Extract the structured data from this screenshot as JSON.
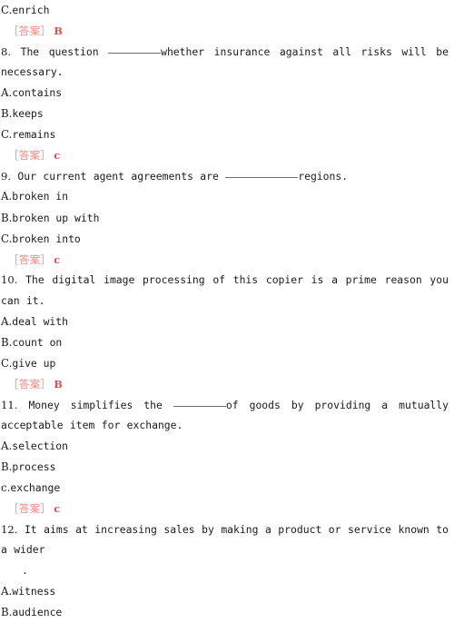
{
  "document": {
    "background_color": "#ffffff",
    "text_color": "#1b1b1b",
    "answer_color": "#e8736f",
    "answer_value_color": "#d9534f",
    "answer_label": "［答案］"
  },
  "top_partial_option": {
    "letter": "C.",
    "text": "enrich"
  },
  "top_partial_answer": {
    "label": "［答案］",
    "value": "B"
  },
  "questions": [
    {
      "number": "8.",
      "stem_before": " The question ",
      "blank": "short",
      "stem_after": "whether insurance against all risks will be necessary.",
      "options": [
        {
          "letter": "A.",
          "text": "contains"
        },
        {
          "letter": "B.",
          "text": "keeps"
        },
        {
          "letter": "C.",
          "text": "remains"
        }
      ],
      "answer": {
        "label": "［答案］",
        "value": "c"
      }
    },
    {
      "number": "9.",
      "stem_before": " Our current agent agreements are ",
      "blank": "long",
      "stem_after": "regions.",
      "options": [
        {
          "letter": "A.",
          "text": "broken in"
        },
        {
          "letter": "B.",
          "text": "broken up with"
        },
        {
          "letter": "C.",
          "text": "broken into"
        }
      ],
      "answer": {
        "label": "［答案］",
        "value": "c"
      }
    },
    {
      "number": "10.",
      "stem_before": " The digital image processing of this copier is a prime reason you can",
      "blank": "none",
      "stem_after": " it.",
      "options": [
        {
          "letter": "A.",
          "text": "deal with"
        },
        {
          "letter": "B.",
          "text": "count on"
        },
        {
          "letter": "C.",
          "text": "give up"
        }
      ],
      "answer": {
        "label": "［答案］",
        "value": "B"
      }
    },
    {
      "number": "11.",
      "stem_before": " Money simplifies the ",
      "blank": "short",
      "stem_after": "of goods by providing a mutually acceptable item for exchange.",
      "options": [
        {
          "letter": "A.",
          "text": "selection"
        },
        {
          "letter": "B.",
          "text": "process"
        },
        {
          "letter": "c.",
          "text": "exchange"
        }
      ],
      "answer": {
        "label": "［答案］",
        "value": "c"
      }
    },
    {
      "number": "12.",
      "stem_before": " It aims at increasing sales by making a product or service known to a wider",
      "blank": "none",
      "stem_after": "",
      "trailing_period_line": ".",
      "options": [
        {
          "letter": "A.",
          "text": "witness"
        },
        {
          "letter": "B.",
          "text": "audience"
        }
      ],
      "answer": null
    }
  ]
}
